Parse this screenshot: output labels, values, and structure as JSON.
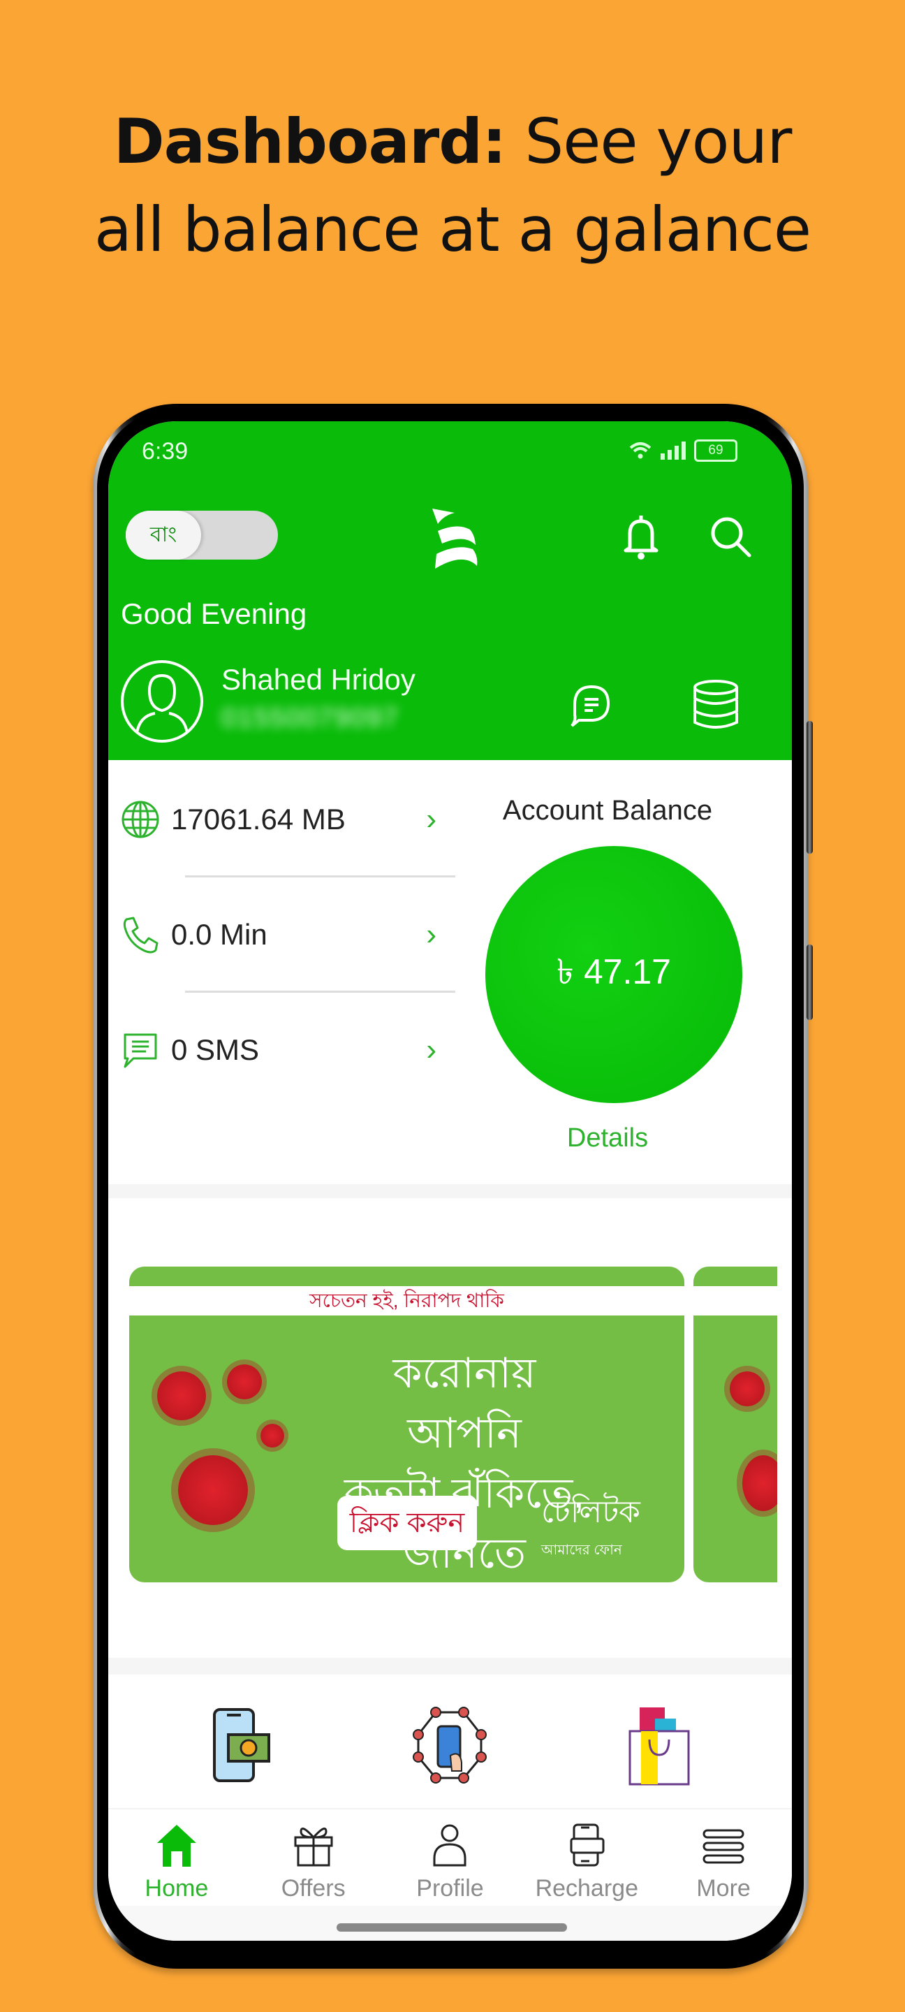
{
  "headline": {
    "bold": "Dashboard:",
    "rest_line1": " See your",
    "line2": "all balance at a galance"
  },
  "status_bar": {
    "time": "6:39",
    "battery": "69",
    "icons": [
      "wifi-icon",
      "signal-icon",
      "battery-icon"
    ]
  },
  "header": {
    "language_toggle": "বাং",
    "logo": "teletalk-logo",
    "greeting": "Good Evening",
    "user_name": "Shahed Hridoy",
    "phone_number_blurred": "01550079097",
    "icons": [
      "bell-icon",
      "search-icon",
      "chat-icon",
      "coins-icon"
    ]
  },
  "usage": [
    {
      "icon": "globe-icon",
      "value": "17061.64 MB"
    },
    {
      "icon": "phone-icon",
      "value": "0.0 Min"
    },
    {
      "icon": "sms-icon",
      "value": "0 SMS"
    }
  ],
  "account_balance": {
    "title": "Account Balance",
    "amount": "৳ 47.17",
    "details_label": "Details"
  },
  "banner": {
    "strip_text": "সচেতন হই, নিরাপদ থাকি",
    "main_line1": "করোনায় আপনি",
    "main_line2": "কতটা ঝুঁকিতে, জানতে",
    "cta": "ক্লিক করুন",
    "brand": "টেলিটক",
    "brand_tagline": "আমাদের ফোন"
  },
  "services": [
    {
      "icon": "mobile-money-icon"
    },
    {
      "icon": "network-phone-icon"
    },
    {
      "icon": "shopping-bag-icon"
    }
  ],
  "nav": [
    {
      "label": "Home",
      "icon": "home-icon",
      "active": true
    },
    {
      "label": "Offers",
      "icon": "gift-icon"
    },
    {
      "label": "Profile",
      "icon": "person-icon"
    },
    {
      "label": "Recharge",
      "icon": "recharge-icon"
    },
    {
      "label": "More",
      "icon": "menu-icon"
    }
  ],
  "colors": {
    "background": "#FBA535",
    "brand_green": "#0ABB0A",
    "accent_green": "#2DB22D",
    "banner_green": "#74BE45",
    "banner_red": "#C8102E"
  }
}
